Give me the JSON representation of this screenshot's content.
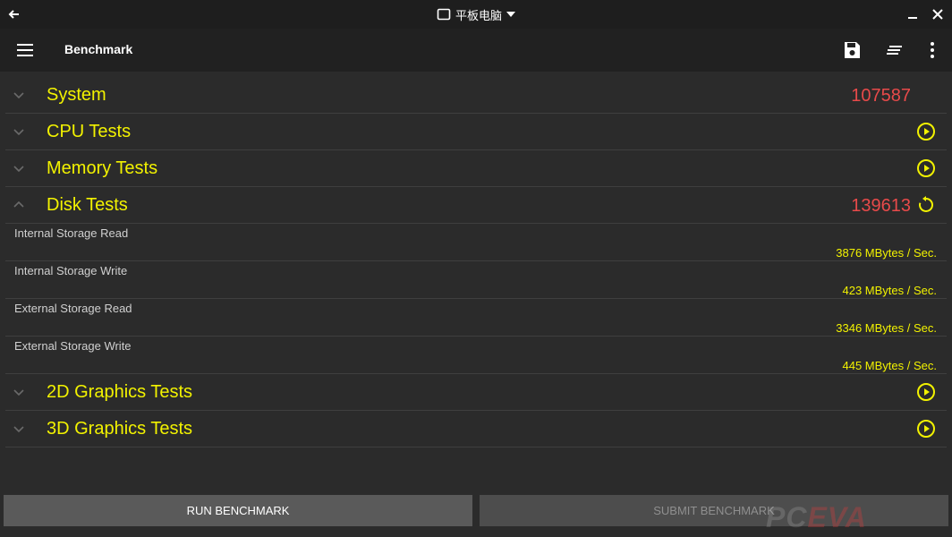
{
  "window": {
    "device_label": "平板电脑",
    "back_icon": "arrow-left-icon",
    "minimize_icon": "minimize-icon",
    "close_icon": "close-icon"
  },
  "appbar": {
    "title": "Benchmark",
    "menu_icon": "hamburger-menu-icon",
    "save_icon": "floppy-disk-icon",
    "sort_icon": "sort-lines-icon",
    "more_icon": "more-vertical-icon"
  },
  "categories": {
    "system": {
      "label": "System",
      "score": "107587",
      "expanded": false
    },
    "cpu": {
      "label": "CPU Tests",
      "action_icon": "play-circle-icon",
      "expanded": false
    },
    "memory": {
      "label": "Memory Tests",
      "action_icon": "play-circle-icon",
      "expanded": false
    },
    "disk": {
      "label": "Disk Tests",
      "score": "139613",
      "action_icon": "refresh-icon",
      "expanded": true,
      "results": [
        {
          "name": "Internal Storage Read",
          "value": "3876 MBytes / Sec."
        },
        {
          "name": "Internal Storage Write",
          "value": "423 MBytes / Sec."
        },
        {
          "name": "External Storage Read",
          "value": "3346 MBytes / Sec."
        },
        {
          "name": "External Storage Write",
          "value": "445 MBytes / Sec."
        }
      ]
    },
    "graphics2d": {
      "label": "2D Graphics Tests",
      "action_icon": "play-circle-icon",
      "expanded": false
    },
    "graphics3d": {
      "label": "3D Graphics Tests",
      "action_icon": "play-circle-icon",
      "expanded": false
    }
  },
  "buttons": {
    "run": "RUN BENCHMARK",
    "submit": "SUBMIT BENCHMARK"
  },
  "watermark": {
    "part1": "PC",
    "part2": "EVA"
  },
  "colors": {
    "accent_yellow": "#f2f200",
    "score_red": "#e84a4a",
    "background": "#2b2b2b",
    "appbar": "#212121"
  }
}
